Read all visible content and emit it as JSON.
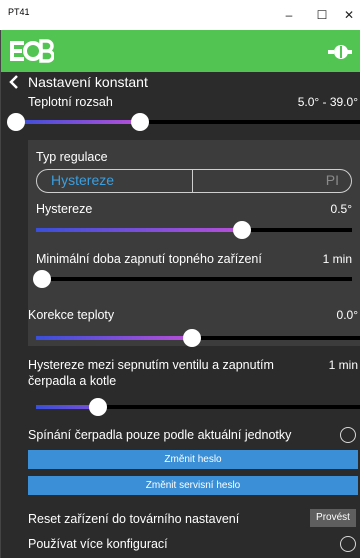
{
  "window": {
    "title": "PT41",
    "min": "–",
    "max": "☐",
    "close": "✕"
  },
  "nav": {
    "title": "Nastavení konstant"
  },
  "temp_range": {
    "label": "Teplotní rozsah",
    "value": "5.0° - 39.0°",
    "low_fraction": 0.0,
    "high_fraction": 0.36
  },
  "regulation": {
    "label": "Typ regulace",
    "options": [
      "Hystereze",
      "PI"
    ],
    "selected": "Hystereze"
  },
  "hysteresis": {
    "label": "Hystereze",
    "value": "0.5°",
    "fraction": 0.64
  },
  "min_on_time": {
    "label": "Minimální doba zapnutí topného zařízení",
    "value": "1 min",
    "fraction": 0.0
  },
  "correction": {
    "label": "Korekce teploty",
    "value": "0.0°",
    "fraction": 0.5
  },
  "valve_hyst": {
    "label_line1": "Hystereze mezi sepnutím ventilu a zapnutím",
    "label_line2": "čerpadla a kotle",
    "value": "1 min",
    "fraction": 0.2
  },
  "pump_switch": {
    "label": "Spínání čerpadla pouze podle aktuální jednotky",
    "checked": false
  },
  "buttons": {
    "change_password": "Změnit heslo",
    "change_service_password": "Změnit servisní heslo",
    "reset_action": "Provést"
  },
  "reset": {
    "label": "Reset zařízení do továrního nastavení"
  },
  "multi_config": {
    "label": "Používat více konfigurací",
    "checked": false
  },
  "colors": {
    "accent": "#52c452",
    "blue": "#3a8fd6",
    "slider_gradient_start": "#3a4fd8",
    "slider_gradient_end": "#b84fd8"
  }
}
